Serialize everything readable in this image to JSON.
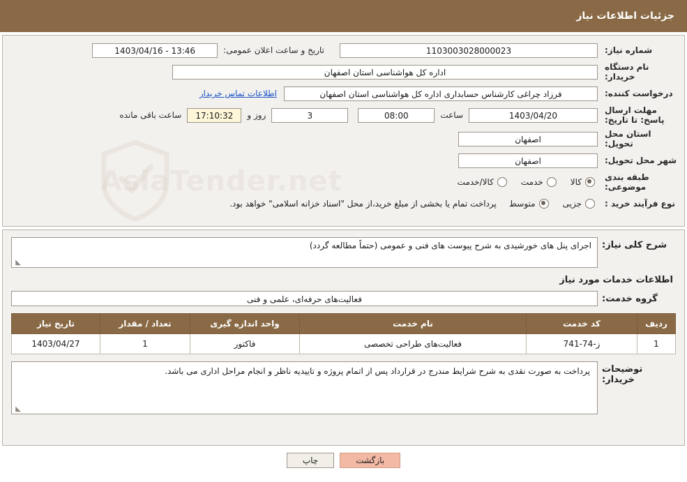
{
  "header": {
    "title": "جزئیات اطلاعات نیاز"
  },
  "watermark": {
    "text": "AsiaTender.net",
    "icon": "shield-icon"
  },
  "top_form": {
    "need_number_label": "شماره نیاز:",
    "need_number_value": "1103003028000023",
    "announce_datetime_label": "تاریخ و ساعت اعلان عمومی:",
    "announce_datetime_value": "13:46 - 1403/04/16",
    "buyer_org_label": "نام دستگاه خریدار:",
    "buyer_org_value": "اداره کل هواشناسی استان اصفهان",
    "requester_label": "درخواست کننده:",
    "requester_value": "فرزاد چراغی کارشناس حسابداری اداره کل هواشناسی استان اصفهان",
    "buyer_contact_link": "اطلاعات تماس خریدار",
    "deadline_label": "مهلت ارسال پاسخ: تا تاریخ:",
    "deadline_date": "1403/04/20",
    "hour_label": "ساعت",
    "hour_value": "08:00",
    "days_value": "3",
    "days_label": "روز و",
    "timer_value": "17:10:32",
    "remaining_label": "ساعت باقی مانده",
    "province_label": "استان محل تحویل:",
    "province_value": "اصفهان",
    "city_label": "شهر محل تحویل:",
    "city_value": "اصفهان",
    "category_label": "طبقه بندی موضوعی:",
    "category_options": [
      {
        "label": "کالا",
        "selected": true
      },
      {
        "label": "خدمت",
        "selected": false
      },
      {
        "label": "کالا/خدمت",
        "selected": false
      }
    ],
    "process_label": "نوع فرآیند خرید :",
    "process_options": [
      {
        "label": "جزیی",
        "selected": false
      },
      {
        "label": "متوسط",
        "selected": true
      }
    ],
    "process_note": "پرداخت تمام یا بخشی از مبلغ خرید،از محل \"اسناد خزانه اسلامی\" خواهد بود."
  },
  "bottom_form": {
    "general_need_label": "شرح کلی نیاز:",
    "general_need_value": "اجرای پنل های خورشیدی به شرح پیوست های فنی و عمومی (حتماً مطالعه گردد)",
    "services_info_title": "اطلاعات خدمات مورد نیاز",
    "service_group_label": "گروه خدمت:",
    "service_group_value": "فعالیت‌های حرفه‌ای، علمی و فنی",
    "table": {
      "columns": [
        "ردیف",
        "کد خدمت",
        "نام خدمت",
        "واحد اندازه گیری",
        "تعداد / مقدار",
        "تاریخ نیاز"
      ],
      "rows": [
        {
          "row": "1",
          "service_code": "ز-74-741",
          "service_name": "فعالیت‌های طراحی تخصصی",
          "unit": "فاکتور",
          "quantity": "1",
          "need_date": "1403/04/27"
        }
      ]
    },
    "buyer_notes_label": "توضیحات خریدار:",
    "buyer_notes_value": "پرداخت به صورت نقدی به شرح شرایط مندرج در قرارداد پس از اتمام پروژه و تاییدیه ناظر و انجام مراحل اداری می باشد."
  },
  "footer": {
    "print_label": "چاپ",
    "back_label": "بازگشت"
  }
}
